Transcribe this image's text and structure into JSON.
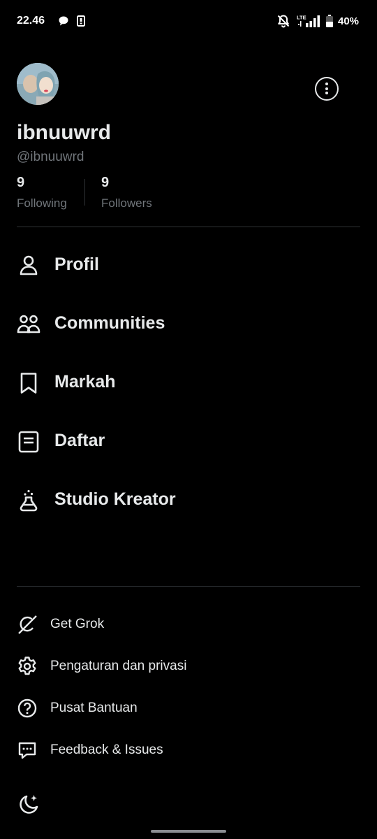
{
  "status_bar": {
    "time": "22.46",
    "network": "LTE",
    "battery": "40%"
  },
  "profile": {
    "display_name": "ibnuuwrd",
    "handle": "@ibnuuwrd",
    "following_count": "9",
    "following_label": "Following",
    "followers_count": "9",
    "followers_label": "Followers"
  },
  "menu": {
    "items": [
      {
        "label": "Profil",
        "icon": "person-icon"
      },
      {
        "label": "Communities",
        "icon": "communities-icon"
      },
      {
        "label": "Markah",
        "icon": "bookmark-icon"
      },
      {
        "label": "Daftar",
        "icon": "list-icon"
      },
      {
        "label": "Studio Kreator",
        "icon": "flask-icon"
      }
    ]
  },
  "secondary_menu": {
    "items": [
      {
        "label": "Get Grok",
        "icon": "grok-icon"
      },
      {
        "label": "Pengaturan dan privasi",
        "icon": "gear-icon"
      },
      {
        "label": "Pusat Bantuan",
        "icon": "help-icon"
      },
      {
        "label": "Feedback & Issues",
        "icon": "feedback-icon"
      }
    ]
  },
  "colors": {
    "background": "#000000",
    "text": "#e7e9ea",
    "muted": "#71767b",
    "divider": "#2f3336"
  }
}
